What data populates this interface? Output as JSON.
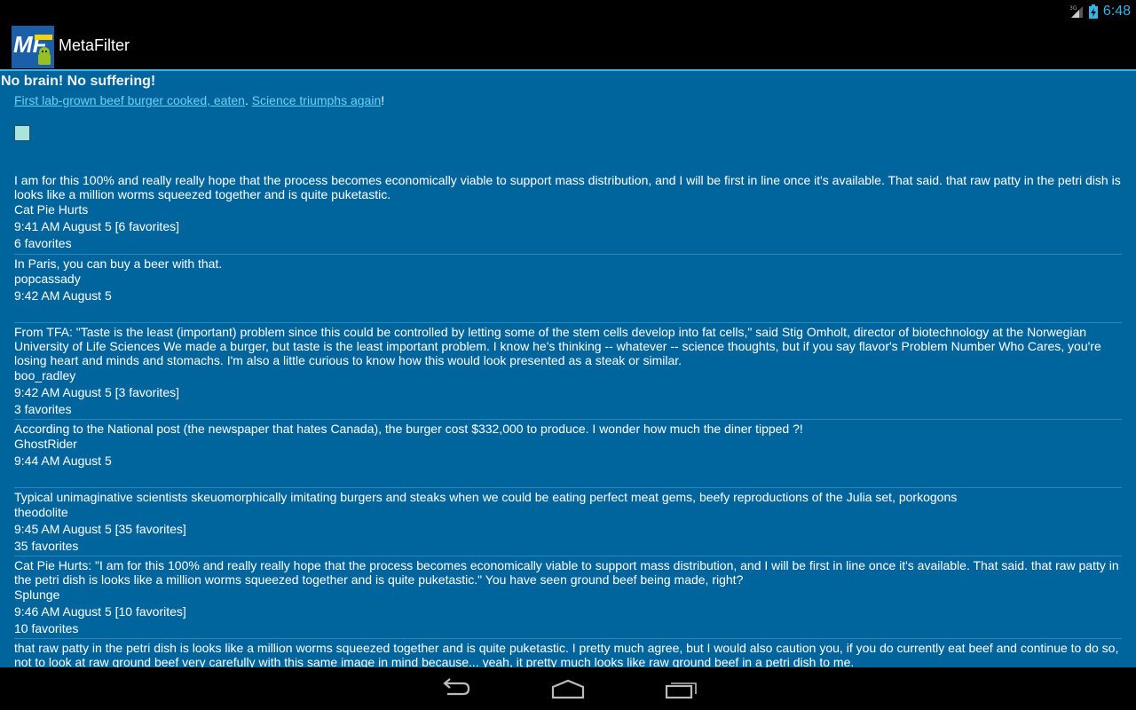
{
  "status": {
    "time": "6:48",
    "signal": "3G"
  },
  "app": {
    "title": "MetaFilter",
    "logo_text": "MF"
  },
  "post": {
    "title": "No brain! No suffering!",
    "link1": "First lab-grown beef burger cooked, eaten",
    "sep": ". ",
    "link2": "Science triumphs again",
    "end": "!"
  },
  "comments": [
    {
      "text": "I am for this 100% and really really hope that the process becomes economically viable to support mass distribution, and I will be first in line once it's available. That said. that raw patty in the petri dish is looks like a million worms squeezed together and is quite puketastic.",
      "author": "Cat Pie Hurts",
      "time": "9:41 AM August 5 [6 favorites]",
      "favorites": "6 favorites"
    },
    {
      "text": "In Paris, you can buy a beer with that.",
      "author": "popcassady",
      "time": "9:42 AM August 5",
      "favorites": ""
    },
    {
      "text": "From TFA: \"Taste is the least (important) problem since this could be controlled by letting some of the stem cells develop into fat cells,\" said Stig Omholt, director of biotechnology at the Norwegian University of Life Sciences We made a burger, but taste is the least important problem. I know he's thinking -- whatever -- science thoughts, but if you say flavor's Problem Number Who Cares, you're losing heart and minds and stomachs. I'm also a little curious to know how this would look presented as a steak or similar.",
      "author": "boo_radley",
      "time": "9:42 AM August 5 [3 favorites]",
      "favorites": "3 favorites"
    },
    {
      "text": "According to the National post (the newspaper that hates Canada), the burger cost $332,000 to produce. I wonder how much the diner tipped ?!",
      "author": "GhostRider",
      "time": "9:44 AM August 5",
      "favorites": ""
    },
    {
      "text": "Typical unimaginative scientists skeuomorphically imitating burgers and steaks when we could be eating perfect meat gems, beefy reproductions of the Julia set, porkogons",
      "author": "theodolite",
      "time": "9:45 AM August 5 [35 favorites]",
      "favorites": "35 favorites"
    },
    {
      "text": "Cat Pie Hurts: \"I am for this 100% and really really hope that the process becomes economically viable to support mass distribution, and I will be first in line once it's available. That said. that raw patty in the petri dish is looks like a million worms squeezed together and is quite puketastic.\" You have seen ground beef being made, right?",
      "author": "Splunge",
      "time": "9:46 AM August 5 [10 favorites]",
      "favorites": "10 favorites"
    },
    {
      "text": "that raw patty in the petri dish is looks like a million worms squeezed together and is quite puketastic. I pretty much agree, but I would also caution you, if you do currently eat beef and continue to do so, not to look at raw ground beef very carefully with this same image in mind because... yeah, it pretty much looks like raw ground beef in a petri dish to me.",
      "author": "",
      "time": "",
      "favorites": ""
    }
  ],
  "nav": {
    "back": "back-icon",
    "home": "home-icon",
    "recents": "recents-icon"
  }
}
